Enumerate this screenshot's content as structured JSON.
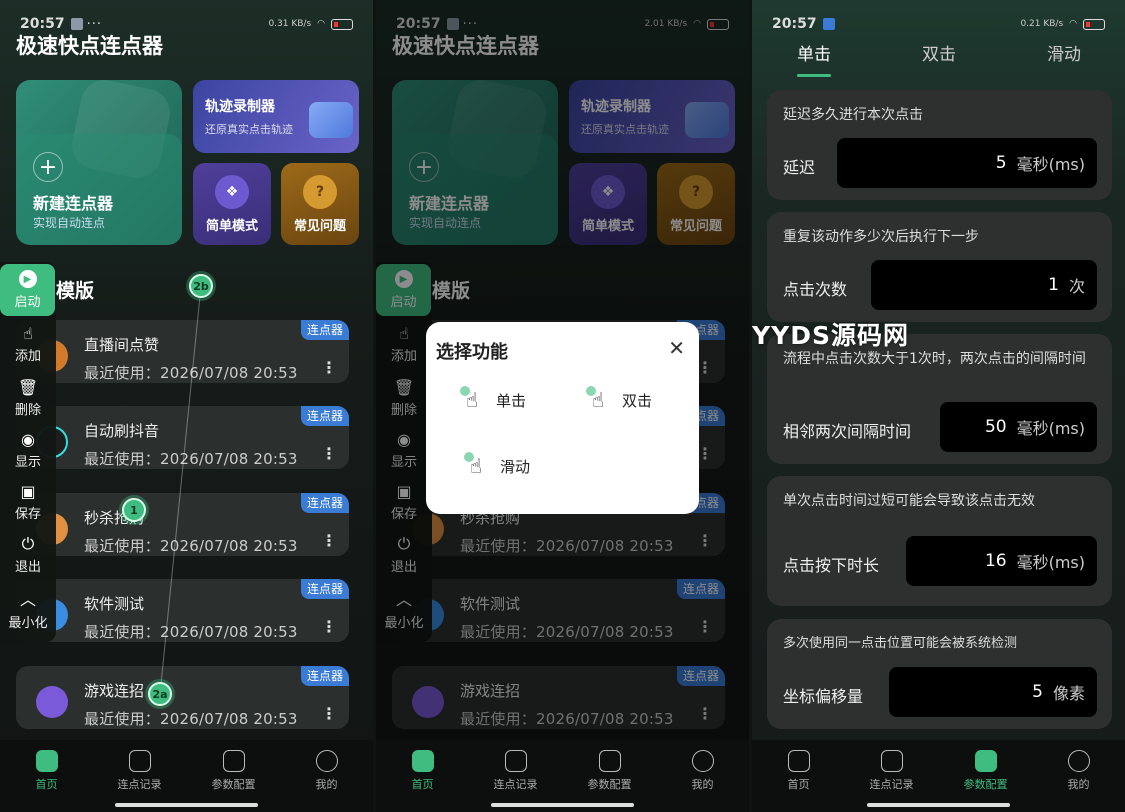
{
  "status": {
    "time": "20:57",
    "speed1": "0.31 KB/s",
    "speed2": "2.01 KB/s",
    "speed3": "0.21 KB/s",
    "battery": "9"
  },
  "home": {
    "title": "极速快点连点器",
    "new_card": {
      "title": "新建连点器",
      "subtitle": "实现自动连点"
    },
    "track_card": {
      "title": "轨迹录制器",
      "subtitle": "还原真实点击轨迹"
    },
    "simple_mode": "简单模式",
    "faq": "常见问题",
    "section_title": "模版",
    "tag_label": "连点器",
    "templates": [
      {
        "name": "直播间点赞",
        "last_used": "最近使用：2026/07/08 20:53"
      },
      {
        "name": "自动刷抖音",
        "last_used": "最近使用：2026/07/08 20:53"
      },
      {
        "name": "秒杀抢购",
        "last_used": "最近使用：2026/07/08 20:53"
      },
      {
        "name": "软件测试",
        "last_used": "最近使用：2026/07/08 20:53"
      },
      {
        "name": "游戏连招",
        "last_used": "最近使用：2026/07/08 20:53"
      }
    ]
  },
  "floating": {
    "start": "启动",
    "add": "添加",
    "delete": "删除",
    "show": "显示",
    "save": "保存",
    "exit": "退出",
    "minimize": "最小化"
  },
  "markers": {
    "m1": "1",
    "m2a": "2a",
    "m2b": "2b"
  },
  "dialog": {
    "title": "选择功能",
    "close": "✕",
    "single": "单击",
    "double": "双击",
    "swipe": "滑动"
  },
  "nav": {
    "home": "首页",
    "records": "连点记录",
    "config": "参数配置",
    "mine": "我的"
  },
  "params": {
    "tabs": {
      "single": "单击",
      "double": "双击",
      "swipe": "滑动"
    },
    "delay": {
      "desc": "延迟多久进行本次点击",
      "label": "延迟",
      "value": "5",
      "unit": "毫秒(ms)"
    },
    "repeat": {
      "desc": "重复该动作多少次后执行下一步",
      "label": "点击次数",
      "value": "1",
      "unit": "次"
    },
    "interval": {
      "desc": "流程中点击次数大于1次时，两次点击的间隔时间",
      "label": "相邻两次间隔时间",
      "value": "50",
      "unit": "毫秒(ms)"
    },
    "press": {
      "desc": "单次点击时间过短可能会导致该点击无效",
      "label": "点击按下时长",
      "value": "16",
      "unit": "毫秒(ms)"
    },
    "offset": {
      "desc": "多次使用同一点击位置可能会被系统检测",
      "label": "坐标偏移量",
      "value": "5",
      "unit": "像素"
    }
  },
  "watermark": "YYDS源码网",
  "colors": {
    "accent": "#3fbd80",
    "tag": "#3a7bd5",
    "track": "#5a5cc0",
    "faq": "#9c6a18"
  }
}
